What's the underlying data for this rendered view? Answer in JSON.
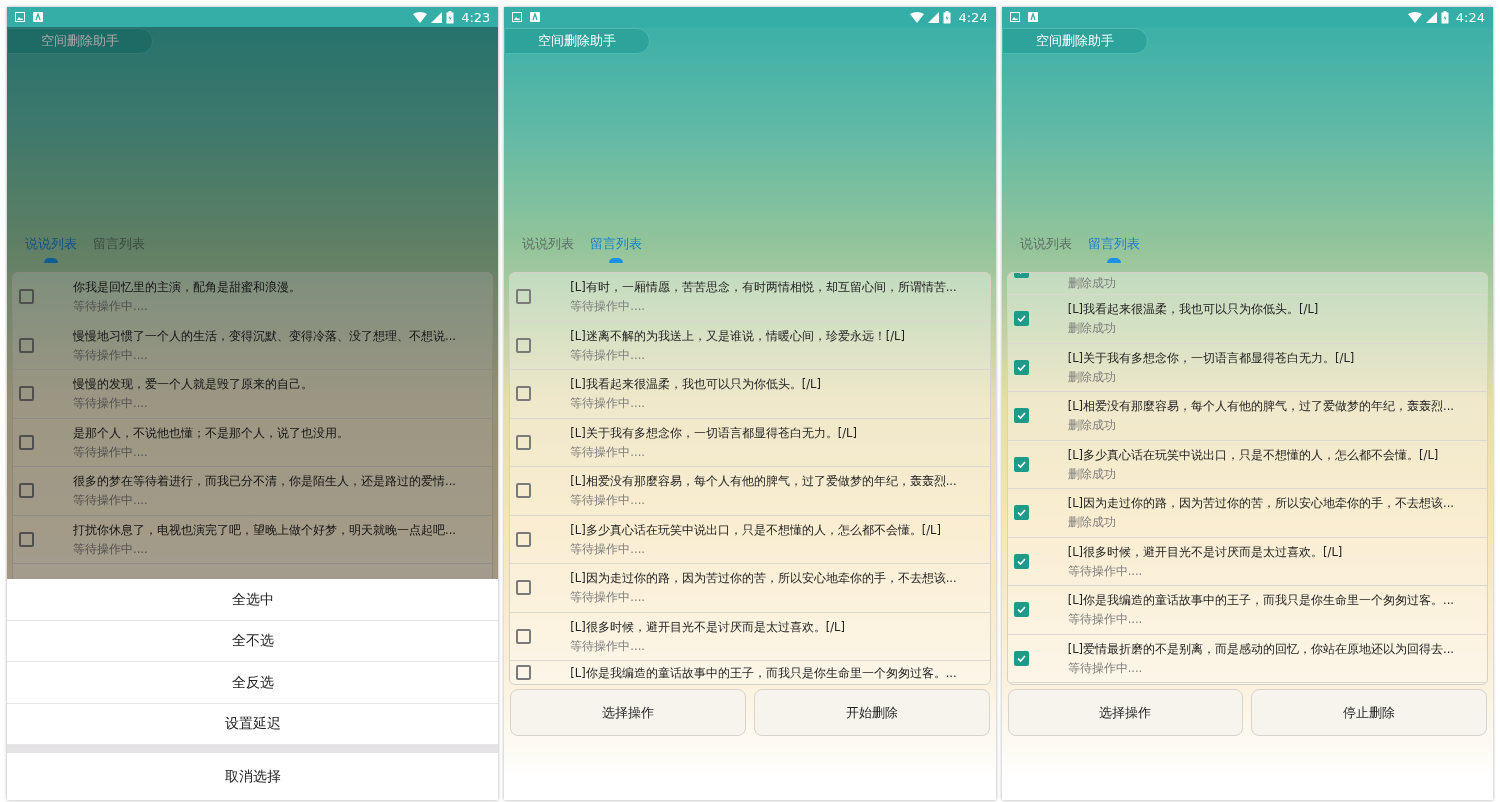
{
  "screens": [
    {
      "status_bar": {
        "time": "4:23"
      },
      "title": "空间删除助手",
      "dimmed": true,
      "tabs": [
        {
          "label": "说说列表",
          "selected": true
        },
        {
          "label": "留言列表",
          "selected": false
        }
      ],
      "rows": [
        {
          "title": "你我是回忆里的主演，配角是甜蜜和浪漫。",
          "status": "等待操作中....",
          "checked": false
        },
        {
          "title": "慢慢地习惯了一个人的生活，变得沉默、变得冷落、没了想理、不想说...",
          "status": "等待操作中....",
          "checked": false
        },
        {
          "title": "慢慢的发现，爱一个人就是毁了原来的自己。",
          "status": "等待操作中....",
          "checked": false
        },
        {
          "title": "是那个人，不说他也懂；不是那个人，说了也没用。",
          "status": "等待操作中....",
          "checked": false
        },
        {
          "title": "很多的梦在等待着进行，而我已分不清，你是陌生人，还是路过的爱情...",
          "status": "等待操作中....",
          "checked": false
        },
        {
          "title": "打扰你休息了，电视也演完了吧，望晚上做个好梦，明天就晚一点起吧...",
          "status": "等待操作中....",
          "checked": false
        }
      ],
      "sheet": {
        "options": [
          "全选中",
          "全不选",
          "全反选",
          "设置延迟"
        ],
        "cancel": "取消选择"
      }
    },
    {
      "status_bar": {
        "time": "4:24"
      },
      "title": "空间删除助手",
      "dimmed": false,
      "tabs": [
        {
          "label": "说说列表",
          "selected": false
        },
        {
          "label": "留言列表",
          "selected": true
        }
      ],
      "rows": [
        {
          "title": "[L]有时，一厢情愿，苦苦思念，有时两情相悦，却互留心间，所谓情苦...",
          "status": "等待操作中....",
          "checked": false
        },
        {
          "title": "[L]迷离不解的为我送上，又是谁说，情暖心间，珍爱永远！[/L]",
          "status": "等待操作中....",
          "checked": false
        },
        {
          "title": "[L]我看起来很温柔，我也可以只为你低头。[/L]",
          "status": "等待操作中....",
          "checked": false
        },
        {
          "title": "[L]关于我有多想念你，一切语言都显得苍白无力。[/L]",
          "status": "等待操作中....",
          "checked": false
        },
        {
          "title": "[L]相爱没有那麼容易，每个人有他的脾气，过了爱做梦的年纪，轰轰烈...",
          "status": "等待操作中....",
          "checked": false
        },
        {
          "title": "[L]多少真心话在玩笑中说出口，只是不想懂的人，怎么都不会懂。[/L]",
          "status": "等待操作中....",
          "checked": false
        },
        {
          "title": "[L]因为走过你的路，因为苦过你的苦，所以安心地牵你的手，不去想该...",
          "status": "等待操作中....",
          "checked": false
        },
        {
          "title": "[L]很多时候，避开目光不是讨厌而是太过喜欢。[/L]",
          "status": "等待操作中....",
          "checked": false
        },
        {
          "title": "[L]你是我编造的童话故事中的王子，而我只是你生命里一个匆匆过客。...",
          "checked": false
        }
      ],
      "buttons": [
        "选择操作",
        "开始删除"
      ]
    },
    {
      "status_bar": {
        "time": "4:24"
      },
      "title": "空间删除助手",
      "dimmed": false,
      "tabs": [
        {
          "label": "说说列表",
          "selected": false
        },
        {
          "label": "留言列表",
          "selected": true
        }
      ],
      "rows": [
        {
          "status": "删除成功",
          "checked": true
        },
        {
          "title": "[L]我看起来很温柔，我也可以只为你低头。[/L]",
          "status": "删除成功",
          "checked": true
        },
        {
          "title": "[L]关于我有多想念你，一切语言都显得苍白无力。[/L]",
          "status": "删除成功",
          "checked": true
        },
        {
          "title": "[L]相爱没有那麼容易，每个人有他的脾气，过了爱做梦的年纪，轰轰烈...",
          "status": "删除成功",
          "checked": true
        },
        {
          "title": "[L]多少真心话在玩笑中说出口，只是不想懂的人，怎么都不会懂。[/L]",
          "status": "删除成功",
          "checked": true
        },
        {
          "title": "[L]因为走过你的路，因为苦过你的苦，所以安心地牵你的手，不去想该...",
          "status": "删除成功",
          "checked": true
        },
        {
          "title": "[L]很多时候，避开目光不是讨厌而是太过喜欢。[/L]",
          "status": "等待操作中....",
          "checked": true
        },
        {
          "title": "[L]你是我编造的童话故事中的王子，而我只是你生命里一个匆匆过客。...",
          "status": "等待操作中....",
          "checked": true
        },
        {
          "title": "[L]爱情最折磨的不是别离，而是感动的回忆，你站在原地还以为回得去...",
          "status": "等待操作中....",
          "checked": true
        }
      ],
      "buttons": [
        "选择操作",
        "停止删除"
      ]
    }
  ]
}
